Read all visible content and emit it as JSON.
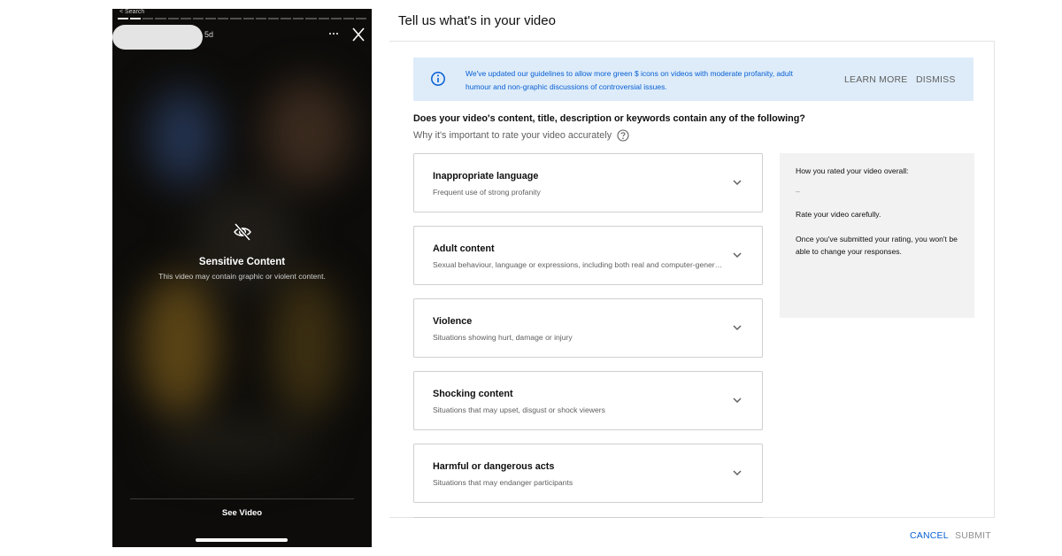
{
  "story": {
    "back_label": "< Search",
    "age": "5d",
    "progress_segments": 20,
    "progress_done": 2,
    "sensitive_title": "Sensitive Content",
    "sensitive_subtitle": "This video may contain graphic or violent content.",
    "see_video_label": "See Video",
    "icons": {
      "more": "more-horizontal-icon",
      "close": "close-icon",
      "sensitive": "eye-off-icon"
    }
  },
  "dialog": {
    "title": "Tell us what's in your video",
    "banner": {
      "text": "We've updated our guidelines to allow more green $ icons on videos with moderate profanity, adult humour and non-graphic discussions of controversial issues.",
      "learn_more": "LEARN MORE",
      "dismiss": "DISMISS",
      "icon": "info-icon",
      "color": "#deecf9"
    },
    "question": "Does your video's content, title, description or keywords contain any of the following?",
    "why_label": "Why it's important to rate your video accurately",
    "categories": [
      {
        "title": "Inappropriate language",
        "subtitle": "Frequent use of strong profanity"
      },
      {
        "title": "Adult content",
        "subtitle": "Sexual behaviour, language or expressions, including both real and computer-generated content"
      },
      {
        "title": "Violence",
        "subtitle": "Situations showing hurt, damage or injury"
      },
      {
        "title": "Shocking content",
        "subtitle": "Situations that may upset, disgust or shock viewers"
      },
      {
        "title": "Harmful or dangerous acts",
        "subtitle": "Situations that may endanger participants"
      }
    ],
    "summary": {
      "title": "How you rated your video overall:",
      "value": "–",
      "line1": "Rate your video carefully.",
      "line2": "Once you've submitted your rating, you won't be able to change your responses."
    },
    "cancel_label": "CANCEL",
    "submit_label": "SUBMIT",
    "accent_color": "#065fd4"
  }
}
